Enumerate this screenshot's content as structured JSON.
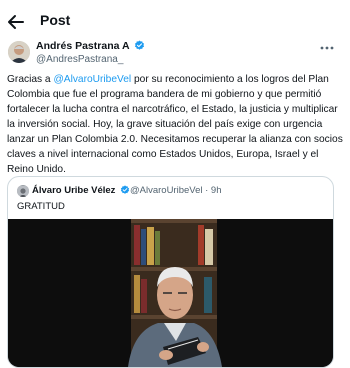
{
  "header": {
    "title": "Post"
  },
  "author": {
    "name": "Andrés Pastrana A",
    "handle": "@AndresPastrana_"
  },
  "tweet": {
    "parts": [
      "Gracias  a  ",
      "@AlvaroUribeVel",
      " por su reconocimiento a los logros del Plan Colombia que fue el programa bandera de mi gobierno y que permitió fortalecer la lucha contra el narcotráfico,  el Estado, la justicia y multiplicar  la inversión social. Hoy, la grave situación del país exige con urgencia lanzar un Plan Colombia 2.0. Necesitamos recuperar la alianza con socios claves a nivel internacional como Estados Unidos, Europa, Israel y el Reino Unido."
    ]
  },
  "quoted": {
    "name": "Álvaro Uribe Vélez",
    "handle_time": "@AlvaroUribeVel · 9h",
    "text": "GRATITUD"
  },
  "colors": {
    "link": "#1d9bf0",
    "verified": "#1d9bf0",
    "muted": "#536471",
    "border": "#cfd9de"
  },
  "icons": [
    "back-arrow-icon",
    "verified-badge-icon",
    "more-options-icon"
  ]
}
